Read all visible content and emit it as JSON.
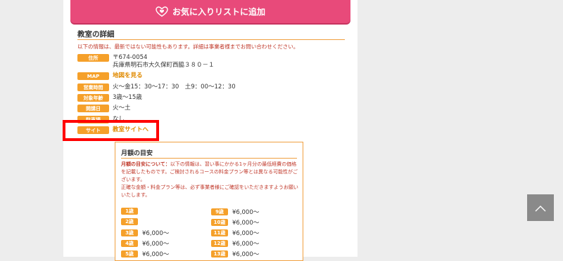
{
  "favorite_button": {
    "label": "お気に入りリストに追加"
  },
  "details": {
    "title": "教室の詳細",
    "notice": "以下の情報は、最新ではない可能性もあります。詳細は事業者様までお問い合わせください。",
    "rows": [
      {
        "label": "住所",
        "lines": [
          "〒674-0054",
          "兵庫県明石市大久保町西脇３８０－１"
        ]
      },
      {
        "label": "MAP",
        "value": "地図を見る"
      },
      {
        "label": "営業時間",
        "value": "火～金15：30～17：30　土9：00～12：30"
      },
      {
        "label": "対象年齢",
        "value": "3歳～15歳"
      },
      {
        "label": "開講日",
        "value": "火～土"
      },
      {
        "label": "駐車場",
        "value": "なし"
      },
      {
        "label": "サイト",
        "value": "教室サイトへ"
      }
    ]
  },
  "monthly": {
    "title": "月額の目安",
    "desc_bold": "月額の目安について：",
    "desc_rest": "以下の情報は、習い事にかかる1ヶ月分の最低経費の価格を記載したものです。ご検討されるコースの料金プラン等とは異なる可能性がございます。",
    "desc2": "正確な金額・料金プラン等は、必ず事業者様にご確認をいただきますようお願いいたします。",
    "left": [
      {
        "age": "1歳",
        "price": ""
      },
      {
        "age": "2歳",
        "price": ""
      },
      {
        "age": "3歳",
        "price": "¥6,000～"
      },
      {
        "age": "4歳",
        "price": "¥6,000～"
      },
      {
        "age": "5歳",
        "price": "¥6,000～"
      }
    ],
    "right": [
      {
        "age": "9歳",
        "price": "¥6,000～"
      },
      {
        "age": "10歳",
        "price": "¥6,000～"
      },
      {
        "age": "11歳",
        "price": "¥6,000～"
      },
      {
        "age": "12歳",
        "price": "¥6,000～"
      },
      {
        "age": "13歳",
        "price": "¥6,000～"
      }
    ]
  },
  "colors": {
    "accent": "#f5a02a",
    "pink": "#e84a7a",
    "highlight": "#ff0000"
  },
  "icons": {
    "favorite": "heart-icon",
    "scroll_top": "chevron-up-icon"
  }
}
